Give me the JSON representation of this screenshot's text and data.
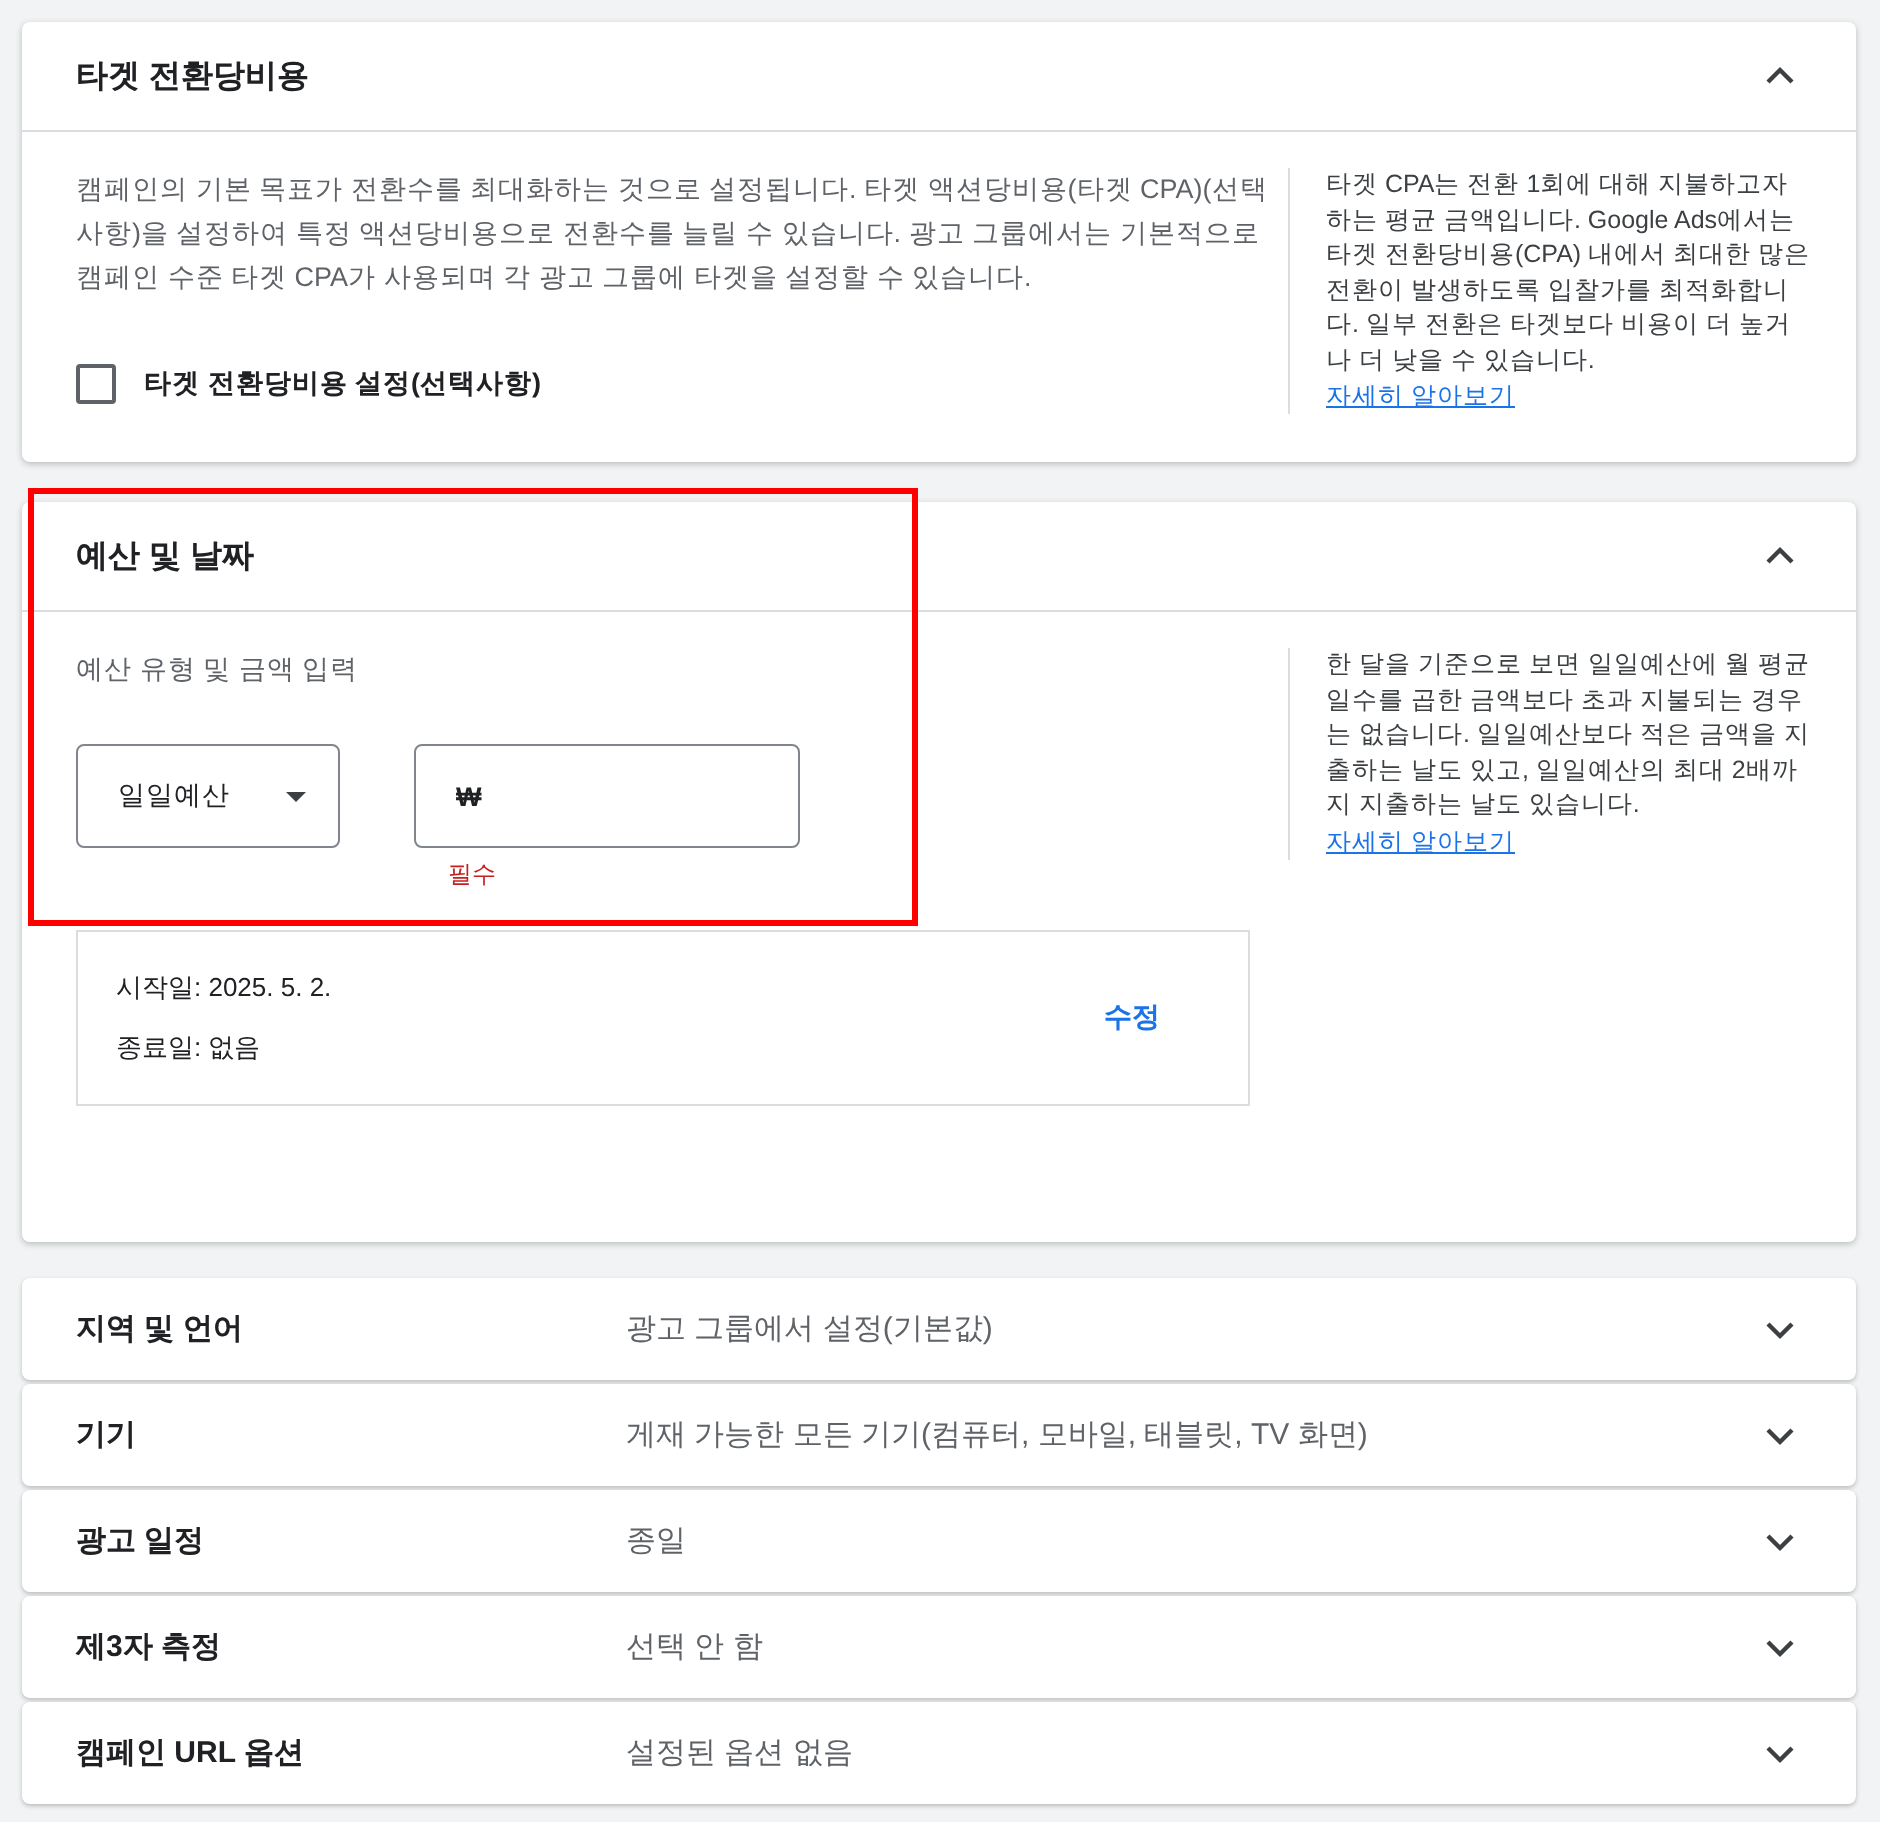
{
  "sections": [
    {
      "kind": "target_cpa",
      "title": "타겟 전환당비용",
      "expanded": true,
      "highlighted": false,
      "description": "캠페인의 기본 목표가 전환수를 최대화하는 것으로 설정됩니다. 타겟 액션당비용(타겟 CPA)(선택사항)을 설정하여 특정 액션당비용으로 전환수를 늘릴 수 있습니다. 광고 그룹에서는 기본적으로 캠페인 수준 타겟 CPA가 사용되며 각 광고 그룹에 타겟을 설정할 수 있습니다.",
      "checkbox": {
        "label": "타겟 전환당비용 설정(선택사항)",
        "checked": false
      },
      "help": {
        "text": "타겟 CPA는 전환 1회에 대해 지불하고자 하는 평균 금액입니다. Google Ads에서는 타겟 전환당비용(CPA) 내에서 최대한 많은 전환이 발생하도록 입찰가를 최적화합니다. 일부 전환은 타겟보다 비용이 더 높거나 더 낮을 수 있습니다.",
        "link": "자세히 알아보기"
      }
    },
    {
      "kind": "budget",
      "title": "예산 및 날짜",
      "expanded": true,
      "highlighted": true,
      "budget_label": "예산 유형 및 금액 입력",
      "budget_type": "일일예산",
      "amount": {
        "value": "₩",
        "error": "필수"
      },
      "dates": [
        "시작일: 2025. 5. 2.",
        "종료일: 없음"
      ],
      "edit_link": "수정",
      "help": {
        "text": "한 달을 기준으로 보면 일일예산에 월 평균 일수를 곱한 금액보다 초과 지불되는 경우는 없습니다. 일일예산보다 적은 금액을 지출하는 날도 있고, 일일예산의 최대 2배까지 지출하는 날도 있습니다.",
        "link": "자세히 알아보기"
      }
    }
  ],
  "settings": [
    {
      "label": "지역 및 언어",
      "value": "광고 그룹에서 설정(기본값)",
      "expanded": false
    },
    {
      "label": "기기",
      "value": "게재 가능한 모든 기기(컴퓨터, 모바일, 태블릿, TV 화면)",
      "expanded": false
    },
    {
      "label": "광고 일정",
      "value": "종일",
      "expanded": false
    },
    {
      "label": "제3자 측정",
      "value": "선택 안 함",
      "expanded": false
    },
    {
      "label": "캠페인 URL 옵션",
      "value": "설정된 옵션 없음",
      "expanded": false
    }
  ]
}
